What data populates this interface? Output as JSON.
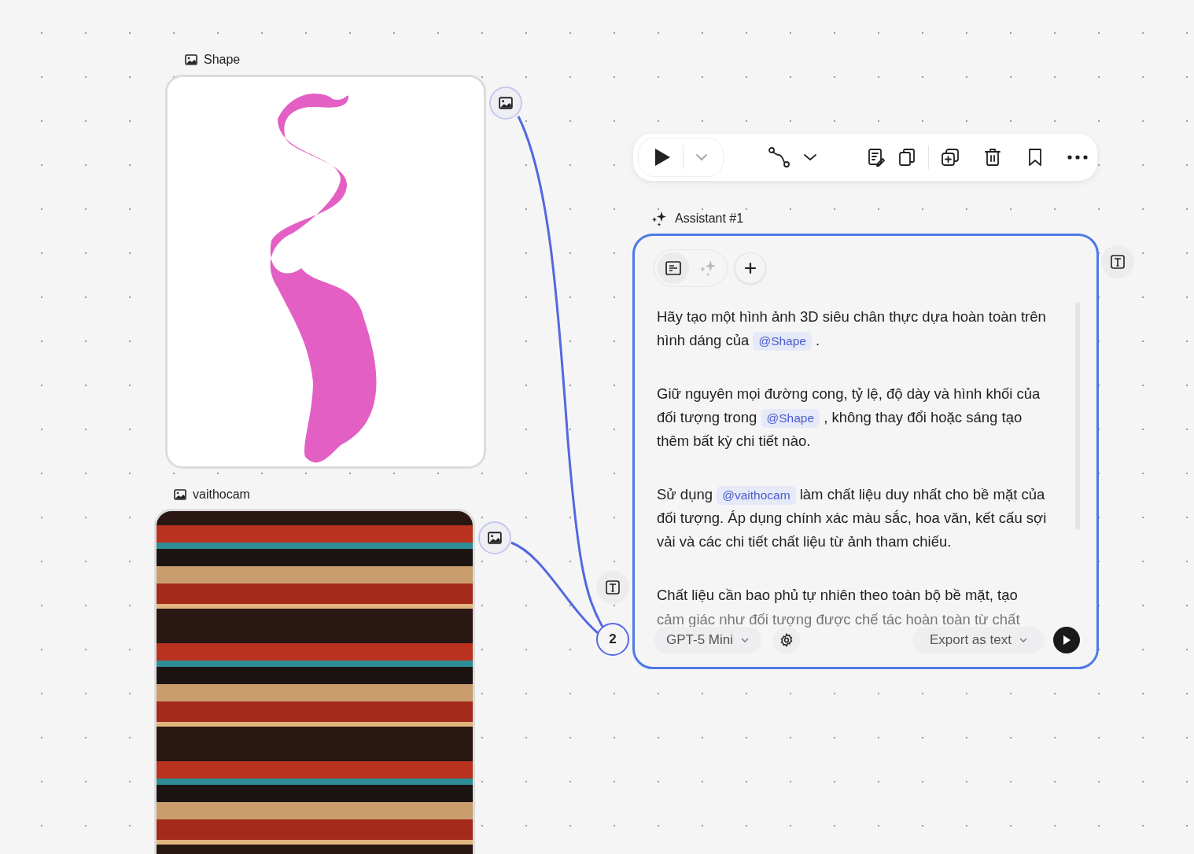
{
  "nodes": [
    {
      "kind": "shape",
      "title": "Shape"
    },
    {
      "kind": "pattern",
      "title": "vaithocam"
    }
  ],
  "toolbar": {
    "run_dropdown_disabled": true
  },
  "assistant": {
    "title": "Assistant #1",
    "mode_tabs": [
      {
        "kind": "list",
        "selected": true
      },
      {
        "kind": "sparkle",
        "selected": false
      }
    ],
    "paragraphs": [
      [
        {
          "text": "Hãy tạo một hình ảnh 3D siêu chân thực dựa hoàn toàn trên hình dáng của "
        },
        {
          "mention": "@Shape"
        },
        {
          "text": " ."
        }
      ],
      [
        {
          "text": "Giữ nguyên mọi đường cong, tỷ lệ, độ dày và hình khối của đối tượng trong "
        },
        {
          "mention": "@Shape"
        },
        {
          "text": " , không thay đổi hoặc sáng tạo thêm bất kỳ chi tiết nào."
        }
      ],
      [
        {
          "text": "Sử dụng "
        },
        {
          "mention": "@vaithocam"
        },
        {
          "text": " làm chất liệu duy nhất cho bề mặt của đối tượng. Áp dụng chính xác màu sắc, hoa văn, kết cấu sợi vải và các chi tiết chất liệu từ ảnh tham chiếu."
        }
      ],
      [
        {
          "text": "Chất liệu cần bao phủ tự nhiên theo toàn bộ bề mặt, tạo"
        }
      ]
    ],
    "faded_line": "cảm giác như đối tượng được chế tác hoàn toàn từ chất",
    "model": "GPT-5 Mini",
    "export": "Export as text"
  },
  "input_count": "2"
}
